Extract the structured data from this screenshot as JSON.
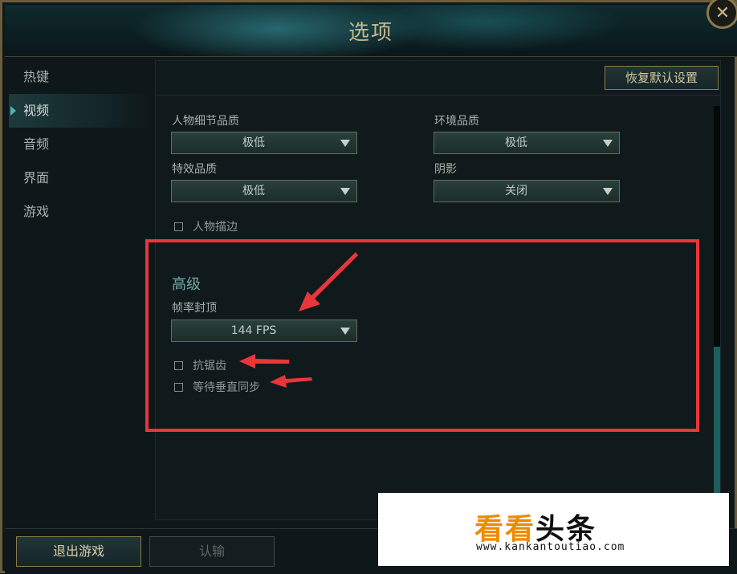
{
  "window": {
    "title": "选项",
    "close_glyph": "✕"
  },
  "sidebar": {
    "items": [
      {
        "label": "热键",
        "active": false
      },
      {
        "label": "视频",
        "active": true
      },
      {
        "label": "音频",
        "active": false
      },
      {
        "label": "界面",
        "active": false
      },
      {
        "label": "游戏",
        "active": false
      }
    ]
  },
  "panel": {
    "reset_label": "恢复默认设置",
    "settings": {
      "character_quality": {
        "label": "人物细节品质",
        "value": "极低"
      },
      "environment_quality": {
        "label": "环境品质",
        "value": "极低"
      },
      "effects_quality": {
        "label": "特效品质",
        "value": "极低"
      },
      "shadows": {
        "label": "阴影",
        "value": "关闭"
      }
    },
    "character_outline": {
      "label": "人物描边",
      "checked": false
    },
    "advanced": {
      "title": "高级",
      "frame_cap": {
        "label": "帧率封顶",
        "value": "144 FPS"
      },
      "anti_aliasing": {
        "label": "抗锯齿",
        "checked": false
      },
      "vsync": {
        "label": "等待垂直同步",
        "checked": false
      }
    }
  },
  "footer": {
    "exit_label": "退出游戏",
    "surrender_label": "认输"
  },
  "watermark": {
    "brand_orange": "看看",
    "brand_black": "头条",
    "url": "www.kankantoutiao.com"
  },
  "colors": {
    "accent_teal": "#4fb3b8",
    "gold_border": "#8a7a4e",
    "annotation_red": "#e8363c",
    "brand_orange": "#f08a00"
  }
}
